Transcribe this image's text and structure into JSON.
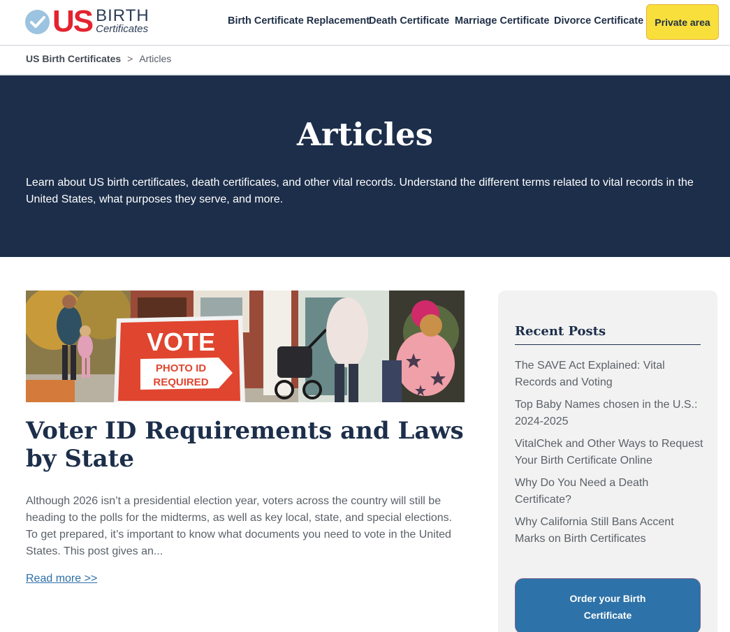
{
  "logo": {
    "us": "US",
    "birth": "BIRTH",
    "certificates": "Certificates"
  },
  "nav": {
    "items": [
      {
        "label": "Birth Certificate Replacement"
      },
      {
        "label": "Death Certificate"
      },
      {
        "label": "Marriage Certificate"
      },
      {
        "label": "Divorce Certificate"
      }
    ],
    "private_area": "Private area"
  },
  "breadcrumb": {
    "home": "US Birth Certificates",
    "separator": ">",
    "current": "Articles"
  },
  "hero": {
    "title": "Articles",
    "description": "Learn about US birth certificates, death certificates, and other vital records. Understand the different terms related to vital records in the United States, what purposes they serve, and more."
  },
  "article": {
    "image": {
      "sign_vote": "VOTE",
      "sign_line1": "PHOTO ID",
      "sign_line2": "REQUIRED"
    },
    "title": "Voter ID Requirements and Laws by State",
    "excerpt": "Although 2026 isn’t a presidential election year, voters across the country will still be heading to the polls for the midterms, as well as key local, state, and special elections. To get prepared, it’s important to know what documents you need to vote in the United States. This post gives an...",
    "read_more": "Read more >>"
  },
  "sidebar": {
    "title": "Recent Posts",
    "posts": [
      "The SAVE Act Explained: Vital Records and Voting",
      "Top Baby Names chosen in the U.S.: 2024-2025",
      "VitalChek and Other Ways to Request Your Birth Certificate Online",
      "Why Do You Need a Death Certificate?",
      "Why California Still Bans Accent Marks on Birth Certificates"
    ],
    "order_button": "Order your Birth Certificate"
  },
  "colors": {
    "navy": "#1c2e4a",
    "accent_red": "#e3232f",
    "private_yellow": "#f8df3b",
    "order_blue": "#2d72a8",
    "link_blue": "#2d6ea8"
  }
}
